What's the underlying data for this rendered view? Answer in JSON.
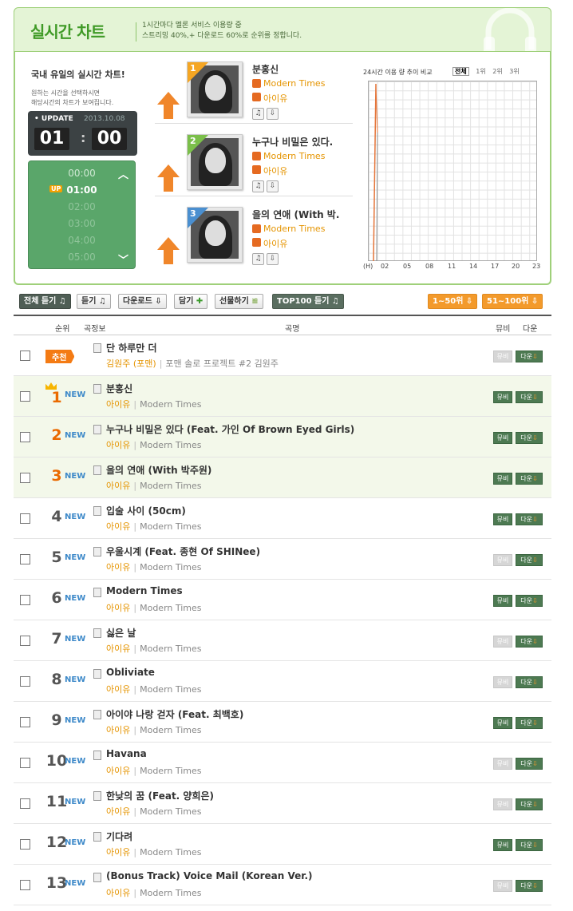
{
  "header": {
    "title": "실시간 차트",
    "desc": "1시간마다 멜론 서비스 이용량 중\n스트리밍 40%,+ 다운로드 60%로 순위를 정합니다."
  },
  "panel": {
    "intro": "국내 유일의 실시간 차트!",
    "sub_line1": "원하는 시간을 선택하시면",
    "sub_line2": "해당시간의 차트가 보여집니다.",
    "sub_hl1": "시간",
    "sub_hl2": "해당시간의",
    "update_label": "UPDATE",
    "update_date": "2013.10.08",
    "hour": "01",
    "minute": "00",
    "colon": ":",
    "up_badge": "UP",
    "times": [
      "00:00",
      "01:00",
      "02:00",
      "03:00",
      "04:00",
      "05:00"
    ]
  },
  "top3": [
    {
      "rank": "1",
      "title": "분홍신",
      "album": "Modern Times",
      "artist": "아이유"
    },
    {
      "rank": "2",
      "title": "누구나 비밀은 있다.",
      "album": "Modern Times",
      "artist": "아이유"
    },
    {
      "rank": "3",
      "title": "을의 연애 (With 박.",
      "album": "Modern Times",
      "artist": "아이유"
    }
  ],
  "graph": {
    "title": "24시간 이용 량 추이 비교",
    "filters": [
      "전체",
      "1위",
      "2위",
      "3위"
    ],
    "hour_unit": "(H)",
    "x_labels": [
      "02",
      "05",
      "08",
      "11",
      "14",
      "17",
      "20",
      "23"
    ]
  },
  "toolbar": {
    "all_listen": "전체 듣기",
    "listen": "듣기",
    "download": "다운로드",
    "add": "담기",
    "gift": "선물하기",
    "top100": "TOP100 듣기",
    "range1": "1~50위",
    "range2": "51~100위"
  },
  "table": {
    "h_rank": "순위",
    "h_info": "곡정보",
    "h_title": "곡명",
    "h_mv": "뮤비",
    "h_dl": "다운",
    "recommend": "추천",
    "new_label": "NEW",
    "mv_label": "뮤비",
    "dl_label": "다운",
    "rows": [
      {
        "rank": "",
        "rec": true,
        "new": false,
        "title": "단 하루만 더",
        "artist": "김원주 (포맨)",
        "album": "포맨 솔로 프로젝트 #2 김원주",
        "mv": false
      },
      {
        "rank": "1",
        "rec": false,
        "new": true,
        "title": "분홍신",
        "artist": "아이유",
        "album": "Modern Times",
        "mv": true
      },
      {
        "rank": "2",
        "rec": false,
        "new": true,
        "title": "누구나 비밀은 있다 (Feat. 가인 Of Brown Eyed Girls)",
        "artist": "아이유",
        "album": "Modern Times",
        "mv": true
      },
      {
        "rank": "3",
        "rec": false,
        "new": true,
        "title": "을의 연애 (With 박주원)",
        "artist": "아이유",
        "album": "Modern Times",
        "mv": true
      },
      {
        "rank": "4",
        "rec": false,
        "new": true,
        "title": "입술 사이 (50cm)",
        "artist": "아이유",
        "album": "Modern Times",
        "mv": true
      },
      {
        "rank": "5",
        "rec": false,
        "new": true,
        "title": "우울시계 (Feat. 종현 Of SHINee)",
        "artist": "아이유",
        "album": "Modern Times",
        "mv": false
      },
      {
        "rank": "6",
        "rec": false,
        "new": true,
        "title": "Modern Times",
        "artist": "아이유",
        "album": "Modern Times",
        "mv": true
      },
      {
        "rank": "7",
        "rec": false,
        "new": true,
        "title": "싫은 날",
        "artist": "아이유",
        "album": "Modern Times",
        "mv": false
      },
      {
        "rank": "8",
        "rec": false,
        "new": true,
        "title": "Obliviate",
        "artist": "아이유",
        "album": "Modern Times",
        "mv": false
      },
      {
        "rank": "9",
        "rec": false,
        "new": true,
        "title": "아이야 나랑 걷자 (Feat. 최백호)",
        "artist": "아이유",
        "album": "Modern Times",
        "mv": true
      },
      {
        "rank": "10",
        "rec": false,
        "new": true,
        "title": "Havana",
        "artist": "아이유",
        "album": "Modern Times",
        "mv": false
      },
      {
        "rank": "11",
        "rec": false,
        "new": true,
        "title": "한낮의 꿈 (Feat. 양희은)",
        "artist": "아이유",
        "album": "Modern Times",
        "mv": false
      },
      {
        "rank": "12",
        "rec": false,
        "new": true,
        "title": "기다려",
        "artist": "아이유",
        "album": "Modern Times",
        "mv": true
      },
      {
        "rank": "13",
        "rec": false,
        "new": true,
        "title": "(Bonus Track) Voice Mail (Korean Ver.)",
        "artist": "아이유",
        "album": "Modern Times",
        "mv": false
      }
    ]
  },
  "colors": {
    "brand_green": "#3f9a26",
    "accent_orange": "#f39a2b",
    "new_blue": "#3d89c9",
    "artist_orange": "#e59400"
  }
}
